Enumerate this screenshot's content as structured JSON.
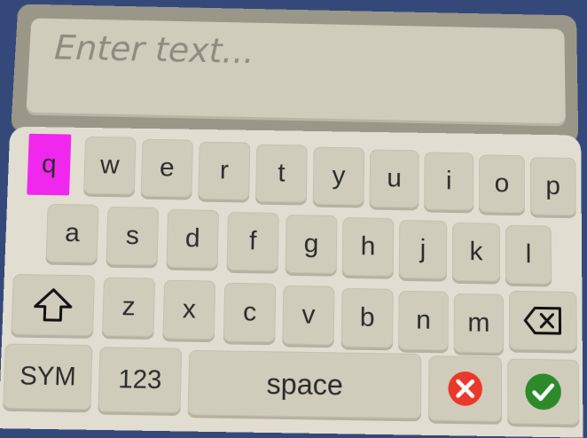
{
  "input": {
    "placeholder": "Enter text..."
  },
  "rows": {
    "row1": [
      "q",
      "w",
      "e",
      "r",
      "t",
      "y",
      "u",
      "i",
      "o",
      "p"
    ],
    "row2": [
      "a",
      "s",
      "d",
      "f",
      "g",
      "h",
      "j",
      "k",
      "l"
    ],
    "row3": [
      "z",
      "x",
      "c",
      "v",
      "b",
      "n",
      "m"
    ]
  },
  "bottom": {
    "sym": "SYM",
    "num": "123",
    "space": "space"
  },
  "icons": {
    "shift": "shift-arrow-icon",
    "backspace": "backspace-icon",
    "cancel": "cancel-x-icon",
    "confirm": "checkmark-icon"
  },
  "colors": {
    "background": "#34497a",
    "key": "#d0ccbb",
    "highlight": "#f028ee",
    "cancel": "#e8392b",
    "confirm": "#2c8a2a"
  },
  "state": {
    "highlighted_key": "q"
  }
}
